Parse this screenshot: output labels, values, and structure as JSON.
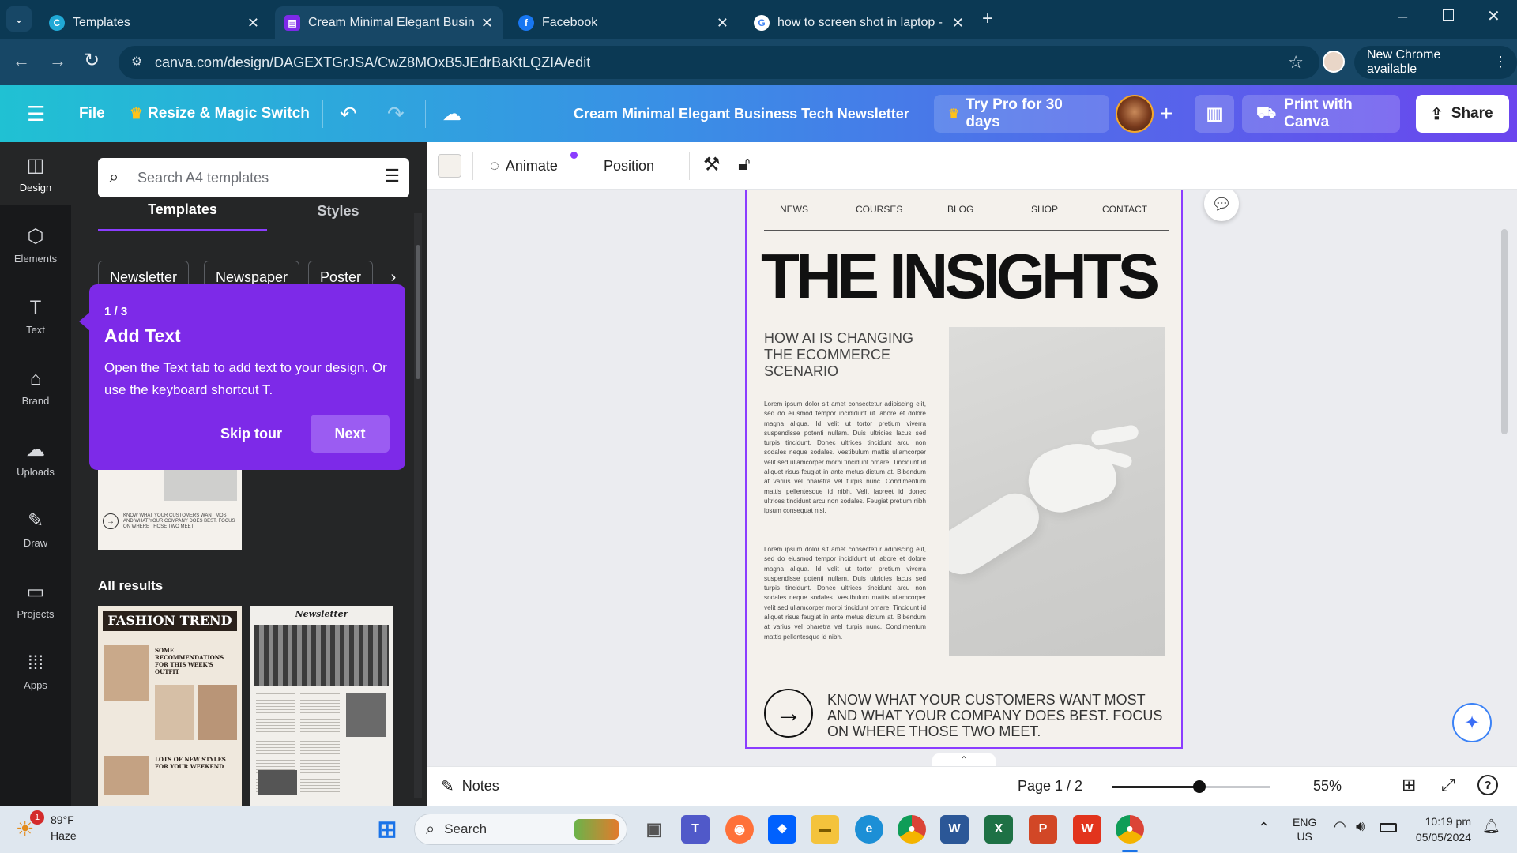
{
  "browser": {
    "tabs": [
      {
        "title": "Templates",
        "icon": "canva-icon"
      },
      {
        "title": "Cream Minimal Elegant Busines",
        "icon": "canva-doc-icon"
      },
      {
        "title": "Facebook",
        "icon": "facebook-icon"
      },
      {
        "title": "how to screen shot in laptop - G",
        "icon": "google-icon"
      }
    ],
    "url": "canva.com/design/DAGEXTGrJSA/CwZ8MOxB5JEdrBaKtLQZIA/edit",
    "update_label": "New Chrome available"
  },
  "canva_top": {
    "file": "File",
    "resize": "Resize & Magic Switch",
    "doc_title": "Cream  Minimal Elegant Business Tech Newsletter",
    "try_pro": "Try Pro for 30 days",
    "print": "Print with Canva",
    "share": "Share"
  },
  "rail": [
    {
      "label": "Design",
      "icon": "design-icon"
    },
    {
      "label": "Elements",
      "icon": "elements-icon"
    },
    {
      "label": "Text",
      "icon": "text-icon"
    },
    {
      "label": "Brand",
      "icon": "brand-icon"
    },
    {
      "label": "Uploads",
      "icon": "uploads-icon"
    },
    {
      "label": "Draw",
      "icon": "draw-icon"
    },
    {
      "label": "Projects",
      "icon": "projects-icon"
    },
    {
      "label": "Apps",
      "icon": "apps-icon"
    }
  ],
  "panel": {
    "search_placeholder": "Search A4 templates",
    "tab_templates": "Templates",
    "tab_styles": "Styles",
    "chips": [
      "Newsletter",
      "Newspaper",
      "Poster"
    ],
    "all_results": "All results",
    "thumb_small_text": "KNOW WHAT YOUR CUSTOMERS WANT MOST AND WHAT YOUR COMPANY DOES BEST. FOCUS ON WHERE THOSE TWO MEET.",
    "fashion_title": "FASHION TREND",
    "fashion_head1": "SOME RECOMMENDATIONS FOR THIS WEEK'S OUTFIT",
    "fashion_head2": "LOTS OF NEW STYLES FOR YOUR WEEKEND",
    "news_title": "Newsletter"
  },
  "tour": {
    "step": "1 / 3",
    "title": "Add Text",
    "body": "Open the Text tab to add text to your design. Or use the keyboard shortcut T.",
    "skip": "Skip tour",
    "next": "Next"
  },
  "toolbar": {
    "animate": "Animate",
    "position": "Position"
  },
  "doc": {
    "nav": [
      "NEWS",
      "COURSES",
      "BLOG",
      "SHOP",
      "CONTACT"
    ],
    "headline": "THE INSIGHTS",
    "subhead": "HOW AI IS CHANGING THE ECOMMERCE SCENARIO",
    "para1": "Lorem ipsum dolor sit amet consectetur adipiscing elit, sed do eiusmod tempor incididunt ut labore et dolore magna aliqua. Id velit ut tortor pretium viverra suspendisse potenti nullam. Duis ultricies lacus sed turpis tincidunt. Donec ultrices tincidunt arcu non sodales neque sodales. Vestibulum mattis ullamcorper velit sed ullamcorper morbi tincidunt ornare. Tincidunt id aliquet risus feugiat in ante metus dictum at. Bibendum at varius vel pharetra vel turpis nunc. Condimentum mattis pellentesque id nibh. Velit laoreet id donec ultrices tincidunt arcu non sodales. Feugiat pretium nibh ipsum consequat nisl.",
    "para2": "Lorem ipsum dolor sit amet consectetur adipiscing elit, sed do eiusmod tempor incididunt ut labore et dolore magna aliqua. Id velit ut tortor pretium viverra suspendisse potenti nullam. Duis ultricies lacus sed turpis tincidunt. Donec ultrices tincidunt arcu non sodales neque sodales. Vestibulum mattis ullamcorper velit sed ullamcorper morbi tincidunt ornare. Tincidunt id aliquet risus feugiat in ante metus dictum at. Bibendum at varius vel pharetra vel turpis nunc. Condimentum mattis pellentesque id nibh.",
    "footer": "KNOW WHAT YOUR CUSTOMERS WANT MOST AND WHAT YOUR COMPANY DOES BEST. FOCUS ON WHERE THOSE TWO MEET."
  },
  "bottom": {
    "notes": "Notes",
    "page": "Page 1 / 2",
    "zoom_label": "55%",
    "zoom": 0.55
  },
  "taskbar": {
    "temp": "89°F",
    "weather": "Haze",
    "weather_badge": "1",
    "search": "Search",
    "lang1": "ENG",
    "lang2": "US",
    "time": "10:19 pm",
    "date": "05/05/2024"
  },
  "colors": {
    "accent": "#8b3dff",
    "chrome_dark": "#0b3954"
  }
}
